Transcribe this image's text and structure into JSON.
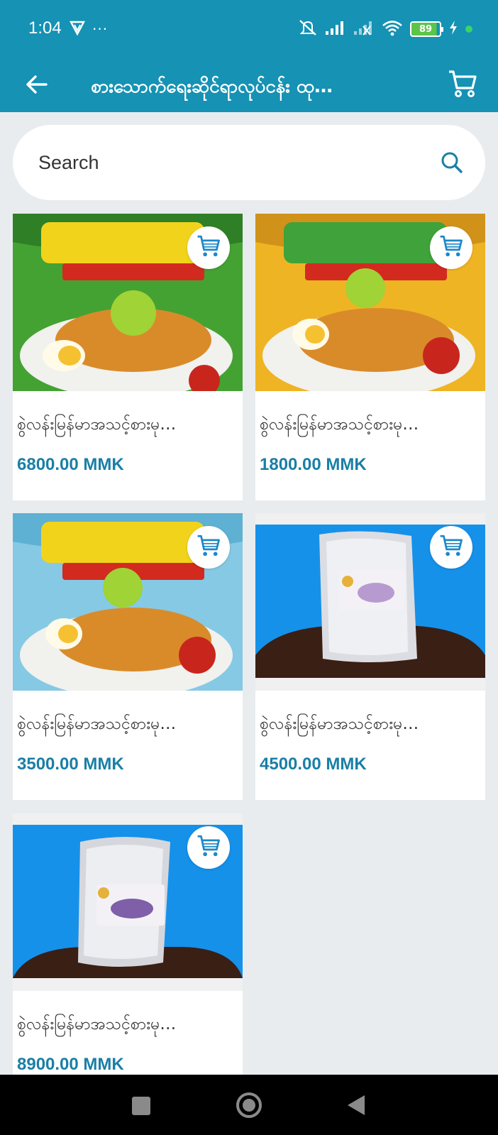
{
  "status_bar": {
    "time": "1:04",
    "more": "···",
    "battery": "89",
    "icons": [
      "vpn-icon",
      "mute-icon",
      "signal-icon",
      "signal-no-icon",
      "wifi-icon",
      "battery-icon",
      "charging-icon"
    ]
  },
  "app_bar": {
    "title": "စားသောက်ရေးဆိုင်ရာလုပ်ငန်း ထု…",
    "icons": [
      "back-arrow-icon",
      "cart-icon"
    ]
  },
  "search": {
    "placeholder": "Search"
  },
  "products": [
    {
      "name": "စွဲလန်းမြန်မာအသင့်စားမု…",
      "price": "6800.00 MMK",
      "image": "green-package"
    },
    {
      "name": "စွဲလန်းမြန်မာအသင့်စားမု…",
      "price": "1800.00 MMK",
      "image": "yellow-package"
    },
    {
      "name": "စွဲလန်းမြန်မာအသင့်စားမု…",
      "price": "3500.00 MMK",
      "image": "blue-package"
    },
    {
      "name": "စွဲလန်းမြန်မာအသင့်စားမု…",
      "price": "4500.00 MMK",
      "image": "silver-pouch"
    },
    {
      "name": "စွဲလန်းမြန်မာအသင့်စားမု…",
      "price": "8900.00 MMK",
      "image": "silver-pouch-large"
    }
  ],
  "colors": {
    "primary": "#1592b4",
    "price": "#1a7fa6",
    "background": "#e9ecee",
    "cart_icon": "#1e88c7"
  }
}
